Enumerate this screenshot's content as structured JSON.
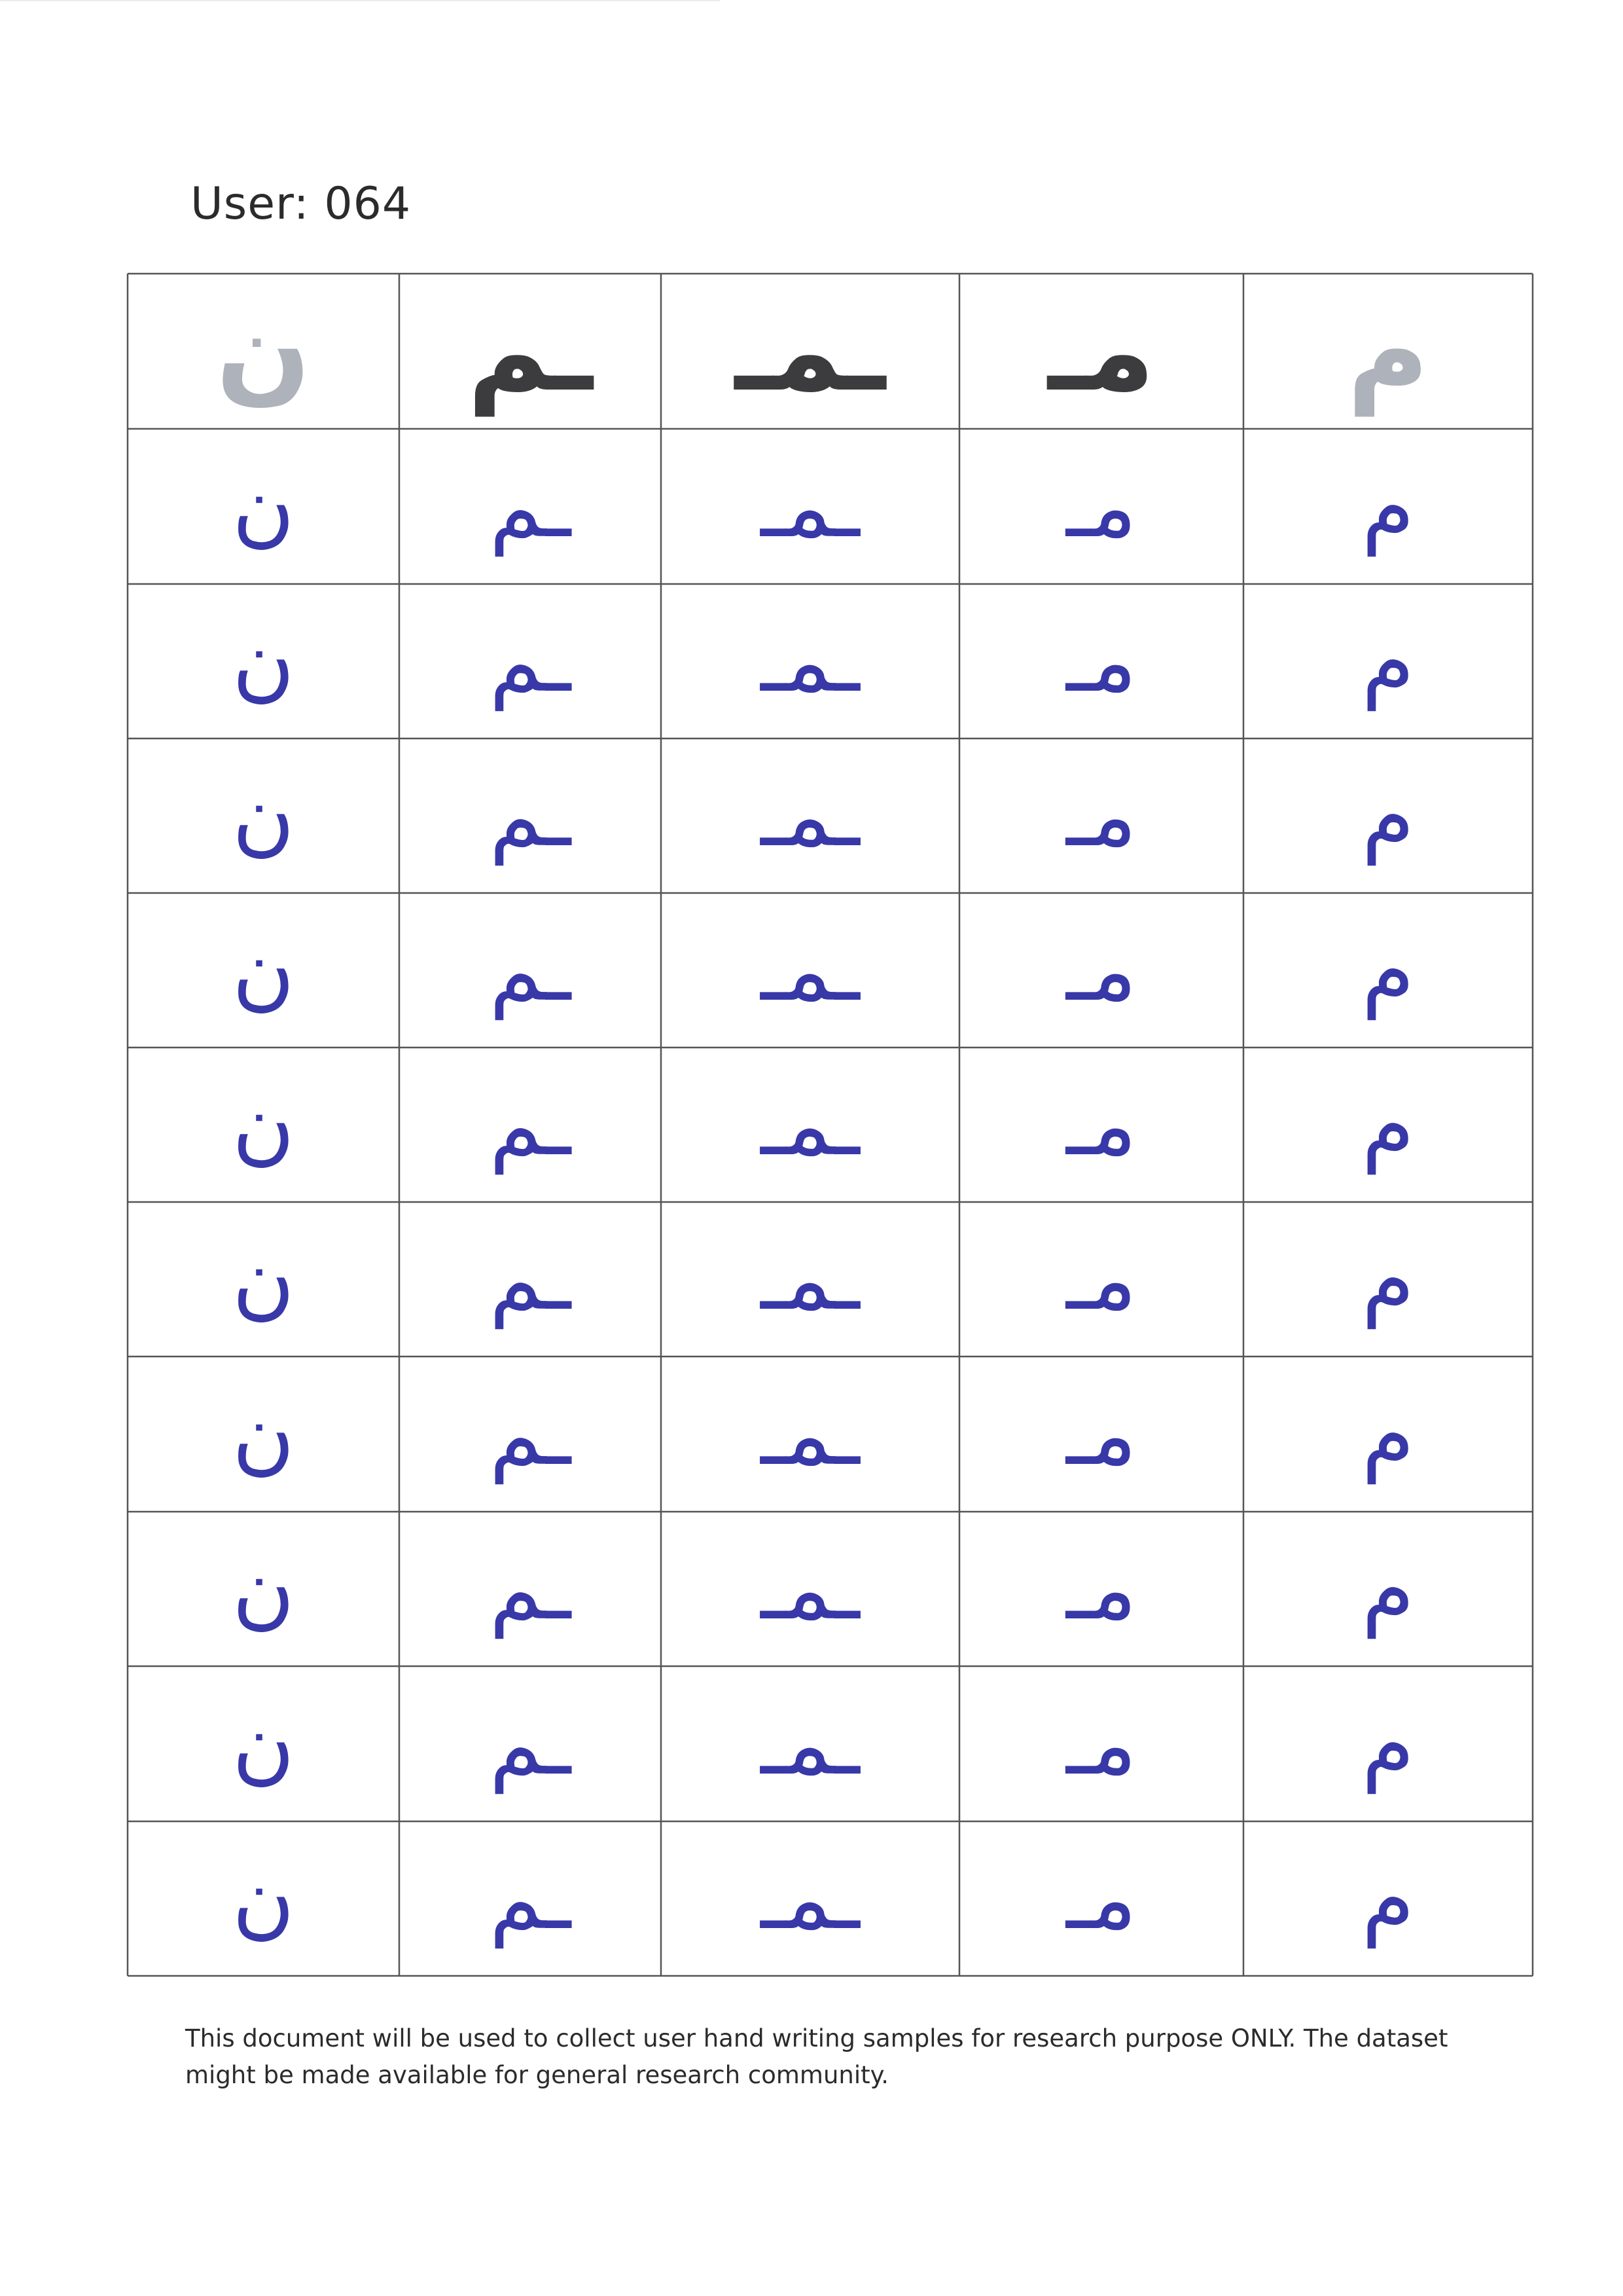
{
  "header": {
    "user_label": "User: 064"
  },
  "table": {
    "reference_row": [
      "ن",
      "ـم",
      "ـمـ",
      "مـ",
      "م"
    ],
    "reference_styles": [
      "light",
      "dark",
      "dark",
      "dark",
      "light"
    ],
    "handwritten_rows": [
      [
        "ن",
        "ـم",
        "ـمـ",
        "مـ",
        "م"
      ],
      [
        "ن",
        "ـم",
        "ـمـ",
        "مـ",
        "م"
      ],
      [
        "ن",
        "ـم",
        "ـمـ",
        "مـ",
        "م"
      ],
      [
        "ن",
        "ـم",
        "ـمـ",
        "مـ",
        "م"
      ],
      [
        "ن",
        "ـم",
        "ـمـ",
        "مـ",
        "م"
      ],
      [
        "ن",
        "ـم",
        "ـمـ",
        "مـ",
        "م"
      ],
      [
        "ن",
        "ـم",
        "ـمـ",
        "مـ",
        "م"
      ],
      [
        "ن",
        "ـم",
        "ـمـ",
        "مـ",
        "م"
      ],
      [
        "ن",
        "ـم",
        "ـمـ",
        "مـ",
        "م"
      ],
      [
        "ن",
        "ـم",
        "ـمـ",
        "مـ",
        "م"
      ]
    ]
  },
  "footer": {
    "note_line1": "This document will be used to collect user hand writing samples for research purpose ONLY. The dataset",
    "note_line2": "might be made available for general research community."
  },
  "colors": {
    "ink": "#3838a8",
    "reference_dark": "#3c3c3e",
    "reference_light": "#aeb2ba",
    "grid_line": "#555555"
  }
}
